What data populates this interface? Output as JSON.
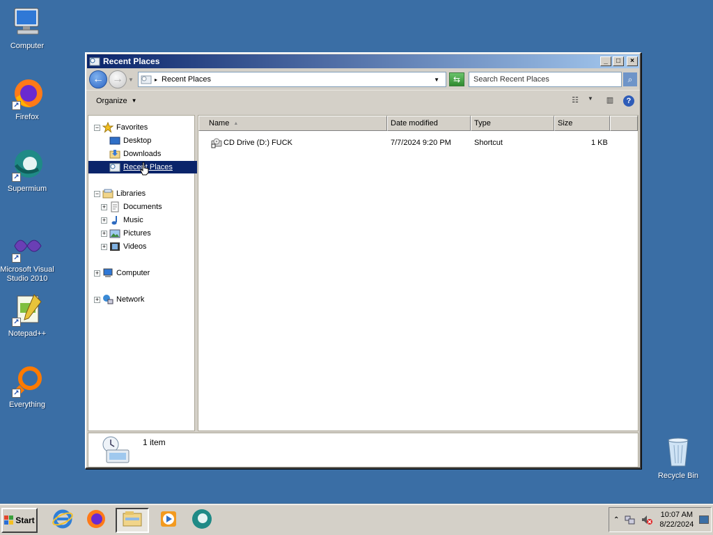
{
  "desktop": {
    "icons": [
      {
        "label": "Computer"
      },
      {
        "label": "Firefox"
      },
      {
        "label": "Supermium"
      },
      {
        "label": "Microsoft Visual Studio 2010"
      },
      {
        "label": "Notepad++"
      },
      {
        "label": "Everything"
      },
      {
        "label": "Recycle Bin"
      }
    ]
  },
  "window": {
    "title": "Recent Places",
    "address": "Recent Places",
    "search_placeholder": "Search Recent Places",
    "organize_label": "Organize",
    "nav": {
      "favorites": "Favorites",
      "desktop": "Desktop",
      "downloads": "Downloads",
      "recent_places": "Recent Places",
      "libraries": "Libraries",
      "documents": "Documents",
      "music": "Music",
      "pictures": "Pictures",
      "videos": "Videos",
      "computer": "Computer",
      "network": "Network"
    },
    "columns": {
      "name": "Name",
      "date_modified": "Date modified",
      "type": "Type",
      "size": "Size"
    },
    "files": [
      {
        "name": "CD Drive (D:) FUCK",
        "date": "7/7/2024 9:20 PM",
        "type": "Shortcut",
        "size": "1 KB"
      }
    ],
    "status": "1 item"
  },
  "taskbar": {
    "start_label": "Start",
    "time": "10:07 AM",
    "date": "8/22/2024"
  },
  "colors": {
    "desktop": "#3a6ea5",
    "titlebar_start": "#0a246a",
    "titlebar_end": "#a6caf0",
    "selection": "#0a246a",
    "chrome": "#d4d0c8"
  }
}
